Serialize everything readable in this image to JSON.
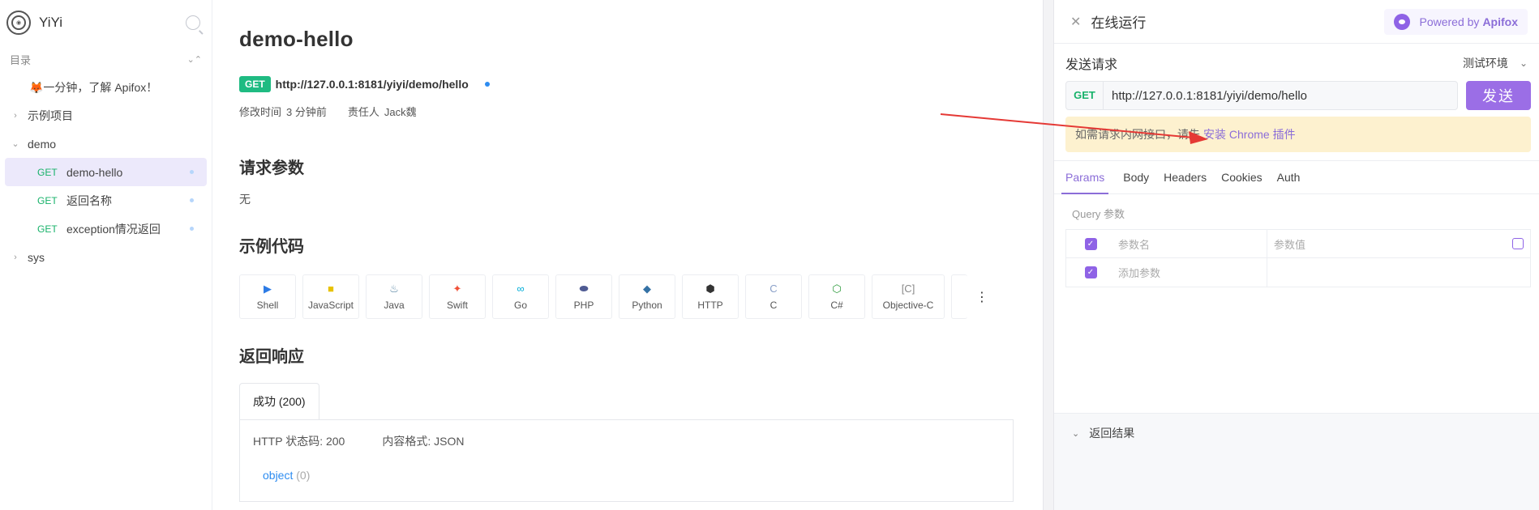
{
  "sidebar": {
    "title": "YiYi",
    "dir_label": "目录",
    "intro": "🦊一分钟，了解 Apifox！",
    "items": [
      {
        "label": "示例项目"
      },
      {
        "label": "demo"
      },
      {
        "method": "GET",
        "label": "demo-hello"
      },
      {
        "method": "GET",
        "label": "返回名称"
      },
      {
        "method": "GET",
        "label": "exception情况返回"
      },
      {
        "label": "sys"
      }
    ]
  },
  "main": {
    "title": "demo-hello",
    "method": "GET",
    "url": "http://127.0.0.1:8181/yiyi/demo/hello",
    "modified_label": "修改时间",
    "modified_value": "3 分钟前",
    "owner_label": "责任人",
    "owner_value": "Jack魏",
    "params_heading": "请求参数",
    "params_none": "无",
    "code_heading": "示例代码",
    "languages": [
      "Shell",
      "JavaScript",
      "Java",
      "Swift",
      "Go",
      "PHP",
      "Python",
      "HTTP",
      "C",
      "C#",
      "Objective-C"
    ],
    "response_heading": "返回响应",
    "response_tab": "成功 (200)",
    "http_status": "HTTP 状态码: 200",
    "content_type": "内容格式: JSON",
    "object_label": "object",
    "object_count": "(0)"
  },
  "run_panel": {
    "title": "在线运行",
    "powered_prefix": "Powered by",
    "powered_brand": "Apifox",
    "send_title": "发送请求",
    "env": "测试环境",
    "method": "GET",
    "url": "http://127.0.0.1:8181/yiyi/demo/hello",
    "send_button": "发送",
    "tip_text": "如需请求内网接口，请先",
    "tip_link": "安装 Chrome 插件",
    "tabs": [
      "Params",
      "Body",
      "Headers",
      "Cookies",
      "Auth"
    ],
    "query_label": "Query 参数",
    "col_name": "参数名",
    "col_value": "参数值",
    "add_param": "添加参数",
    "result_label": "返回结果"
  },
  "colors": {
    "accent": "#8f63e6",
    "get_green": "#17b26a",
    "link_blue": "#2d8cf0",
    "tip_bg": "#fdf1cf",
    "arrow_red": "#e53935"
  }
}
